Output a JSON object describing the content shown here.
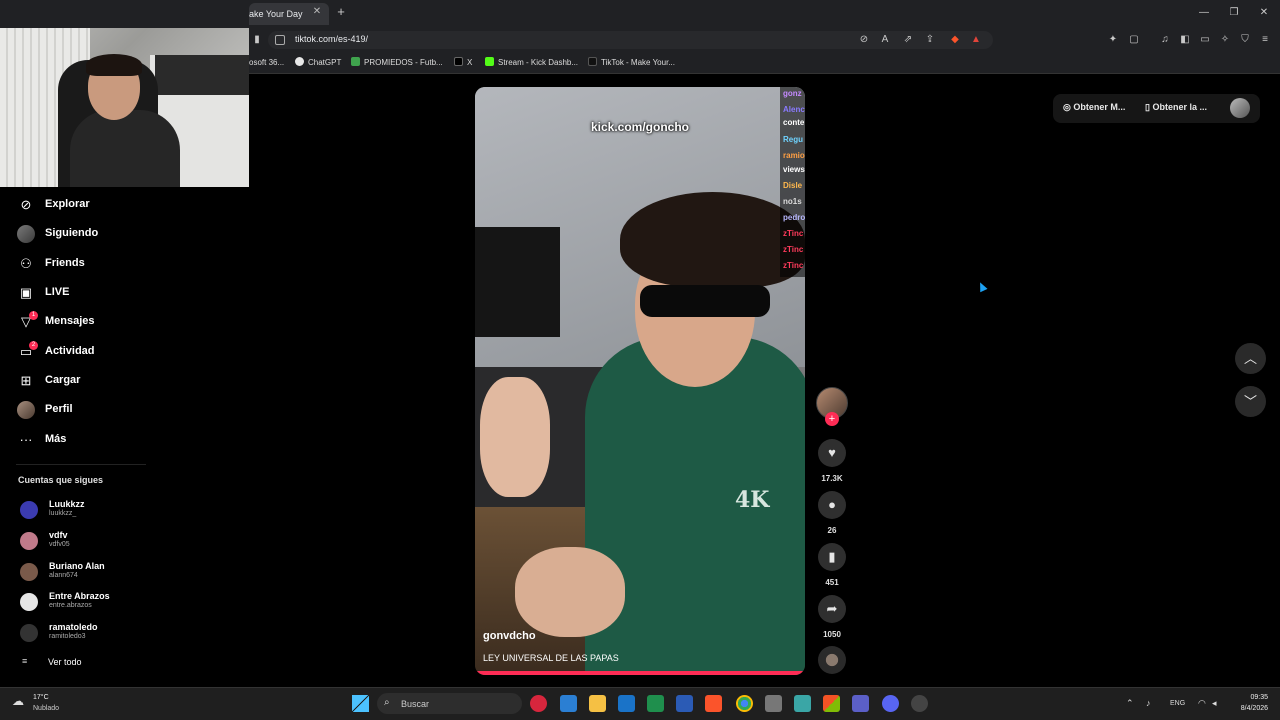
{
  "browser": {
    "active_tab_title": "ake Your Day",
    "url": "tiktok.com/es-419/",
    "bookmarks": [
      {
        "label": "osoft 36...",
        "color": "#444444"
      },
      {
        "label": "ChatGPT",
        "color": "#dddddd"
      },
      {
        "label": "PROMIEDOS - Futb...",
        "color": "#3fa34d"
      },
      {
        "label": "X",
        "color": "#000000"
      },
      {
        "label": "Stream - Kick Dashb...",
        "color": "#53fc18"
      },
      {
        "label": "TikTok - Make Your...",
        "color": "#111111"
      }
    ]
  },
  "sidebar": {
    "nav": [
      {
        "label": "Explorar",
        "icon": "compass-icon",
        "glyph": "⊘"
      },
      {
        "label": "Siguiendo",
        "icon": "following-avatar-icon",
        "glyph": ""
      },
      {
        "label": "Friends",
        "icon": "friends-icon",
        "glyph": "⚇"
      },
      {
        "label": "LIVE",
        "icon": "live-tv-icon",
        "glyph": "▣"
      },
      {
        "label": "Mensajes",
        "icon": "messages-icon",
        "glyph": "▽",
        "badge": "1"
      },
      {
        "label": "Actividad",
        "icon": "activity-icon",
        "glyph": "▭",
        "badge": "2"
      },
      {
        "label": "Cargar",
        "icon": "upload-icon",
        "glyph": "⊞"
      },
      {
        "label": "Perfil",
        "icon": "profile-avatar-icon",
        "glyph": ""
      },
      {
        "label": "Más",
        "icon": "more-icon",
        "glyph": "···"
      }
    ],
    "following_title": "Cuentas que sigues",
    "accounts": [
      {
        "name": "Luukkzz",
        "handle": "luukkzz_",
        "color": "#3b3bb0"
      },
      {
        "name": "vdfv",
        "handle": "vdfv05",
        "color": "#c07a8a"
      },
      {
        "name": "Buriano Alan",
        "handle": "alann674",
        "color": "#7a5a4a"
      },
      {
        "name": "Entre Abrazos",
        "handle": "entre.abrazos",
        "color": "#e6e6e6"
      },
      {
        "name": "ramatoledo",
        "handle": "ramitoledo3",
        "color": "#333333"
      }
    ],
    "see_all": "Ver todo"
  },
  "top_actions": {
    "get_coins": "Obtener M...",
    "get_app": "Obtener la ..."
  },
  "video": {
    "watermark": "kick.com/goncho",
    "chat": [
      {
        "text": "gonz",
        "color": "#c48aff"
      },
      {
        "text": "Alenc",
        "color": "#8a7aff"
      },
      {
        "text": "conte",
        "color": "#ffffff"
      },
      {
        "text": "Regu",
        "color": "#6fd3ff"
      },
      {
        "text": "ramio",
        "color": "#ff9f43"
      },
      {
        "text": "views",
        "color": "#ffffff"
      },
      {
        "text": "Disle",
        "color": "#ffb84d"
      },
      {
        "text": "no1s",
        "color": "#dddddd"
      },
      {
        "text": "pedro",
        "color": "#b8b8ff"
      },
      {
        "text": "zTinc",
        "color": "#ff3b5c"
      },
      {
        "text": "zTinc",
        "color": "#ff3b5c"
      },
      {
        "text": "zTinc",
        "color": "#ff3b5c"
      }
    ],
    "author": "gonvdcho",
    "description": "LEY UNIVERSAL DE LAS PAPAS",
    "shirt_logo": "4K"
  },
  "actions": {
    "likes": "17.3K",
    "comments": "26",
    "saves": "451",
    "shares": "1050"
  },
  "taskbar": {
    "weather_temp": "17°C",
    "weather_desc": "Nublado",
    "search_placeholder": "Buscar",
    "language": "ENG",
    "time": "09:35",
    "date": "8/4/2026"
  }
}
